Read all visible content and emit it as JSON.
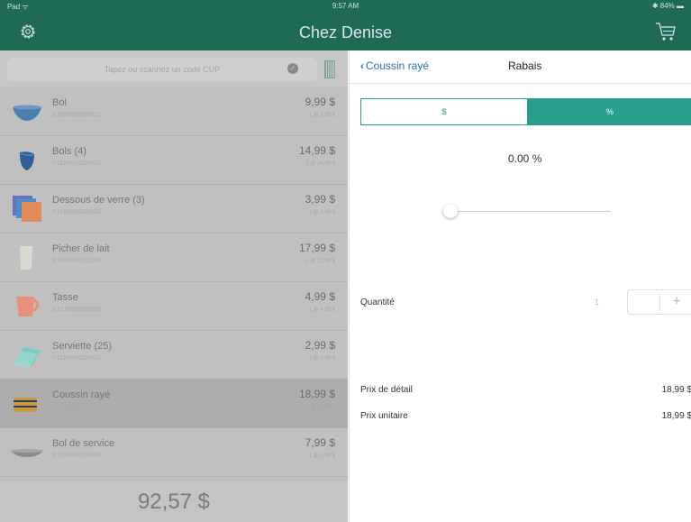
{
  "status": {
    "carrier": "Pad ᯤ",
    "time": "9:57 AM",
    "battery": "✱ 84% ▬"
  },
  "header": {
    "title": "Chez Denise"
  },
  "search": {
    "placeholder": "Tapez ou scannez un code CUP"
  },
  "products": [
    {
      "name": "Bol",
      "sku": "0105868000001",
      "price": "9,99 $",
      "unit": "1 @ 9,99 $"
    },
    {
      "name": "Bols (4)",
      "sku": "0105868000400",
      "price": "14,99 $",
      "unit": "1 @ 14,99 $"
    },
    {
      "name": "Dessous de verre (3)",
      "sku": "0106880000400",
      "price": "3,99 $",
      "unit": "1 @ 3,99 $"
    },
    {
      "name": "Picher de lait",
      "sku": "0106880000100",
      "price": "17,99 $",
      "unit": "1 @ 17,99 $"
    },
    {
      "name": "Tasse",
      "sku": "0107888000800",
      "price": "4,99 $",
      "unit": "1 @ 4,99 $"
    },
    {
      "name": "Serviette (25)",
      "sku": "0108880000400",
      "price": "2,99 $",
      "unit": "1 @ 2,99 $"
    },
    {
      "name": "Coussin rayé",
      "sku": "0105868000500",
      "price": "18,99 $",
      "unit": "1 @ 18,99 $",
      "selected": true
    },
    {
      "name": "Bol de service",
      "sku": "0105868000400",
      "price": "7,99 $",
      "unit": "1 @ 7,99 $"
    }
  ],
  "total": "92,57 $",
  "detail": {
    "back_label": "Coussin rayé",
    "title": "Rabais",
    "seg_dollar": "$",
    "seg_percent": "%",
    "discount_value": "0.00 %",
    "discount_fraction": 0,
    "qty_label": "Quantité",
    "qty_value": "1",
    "plus": "+",
    "retail_label": "Prix de détail",
    "retail_value": "18,99 $",
    "unit_label": "Prix unitaire",
    "unit_value": "18,99 $"
  },
  "colors": {
    "brand": "#1f6a55",
    "accent": "#26a08a",
    "link": "#2a6fb8"
  },
  "icons": {
    "settings": "gear-icon",
    "cart": "cart-icon",
    "clear": "clear-icon",
    "barcode": "barcode-icon"
  }
}
